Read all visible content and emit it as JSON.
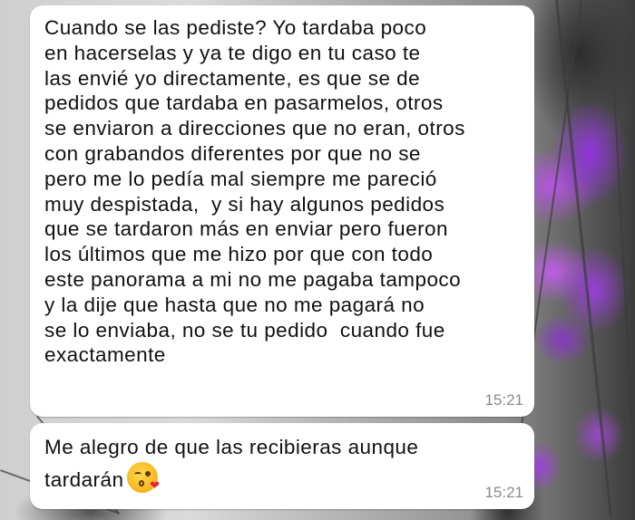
{
  "chat": {
    "messages": [
      {
        "text": "Cuando se las pediste? Yo tardaba poco\nen hacerselas y ya te digo en tu caso te\nlas envié yo directamente, es que se de\npedidos que tardaba en pasarmelos, otros\nse enviaron a direcciones que no eran, otros\ncon grabandos diferentes por que no se\npero me lo pedía mal siempre me pareció\nmuy despistada,  y si hay algunos pedidos\nque se tardaron más en enviar pero fueron\nlos últimos que me hizo por que con todo\neste panorama a mi no me pagaba tampoco\ny la dije que hasta que no me pagará no\nse lo enviaba, no se tu pedido  cuando fue\nexactamente",
        "time": "15:21"
      },
      {
        "text": "Me alegro de que las recibieras aunque\ntardarán",
        "emoji": "kissing-face-with-heart-emoji",
        "time": "15:21"
      }
    ]
  },
  "colors": {
    "bubble_bg": "#ffffff",
    "text": "#111111",
    "timestamp": "#8a8a8a",
    "flower_accent": "#9b3fe0"
  }
}
